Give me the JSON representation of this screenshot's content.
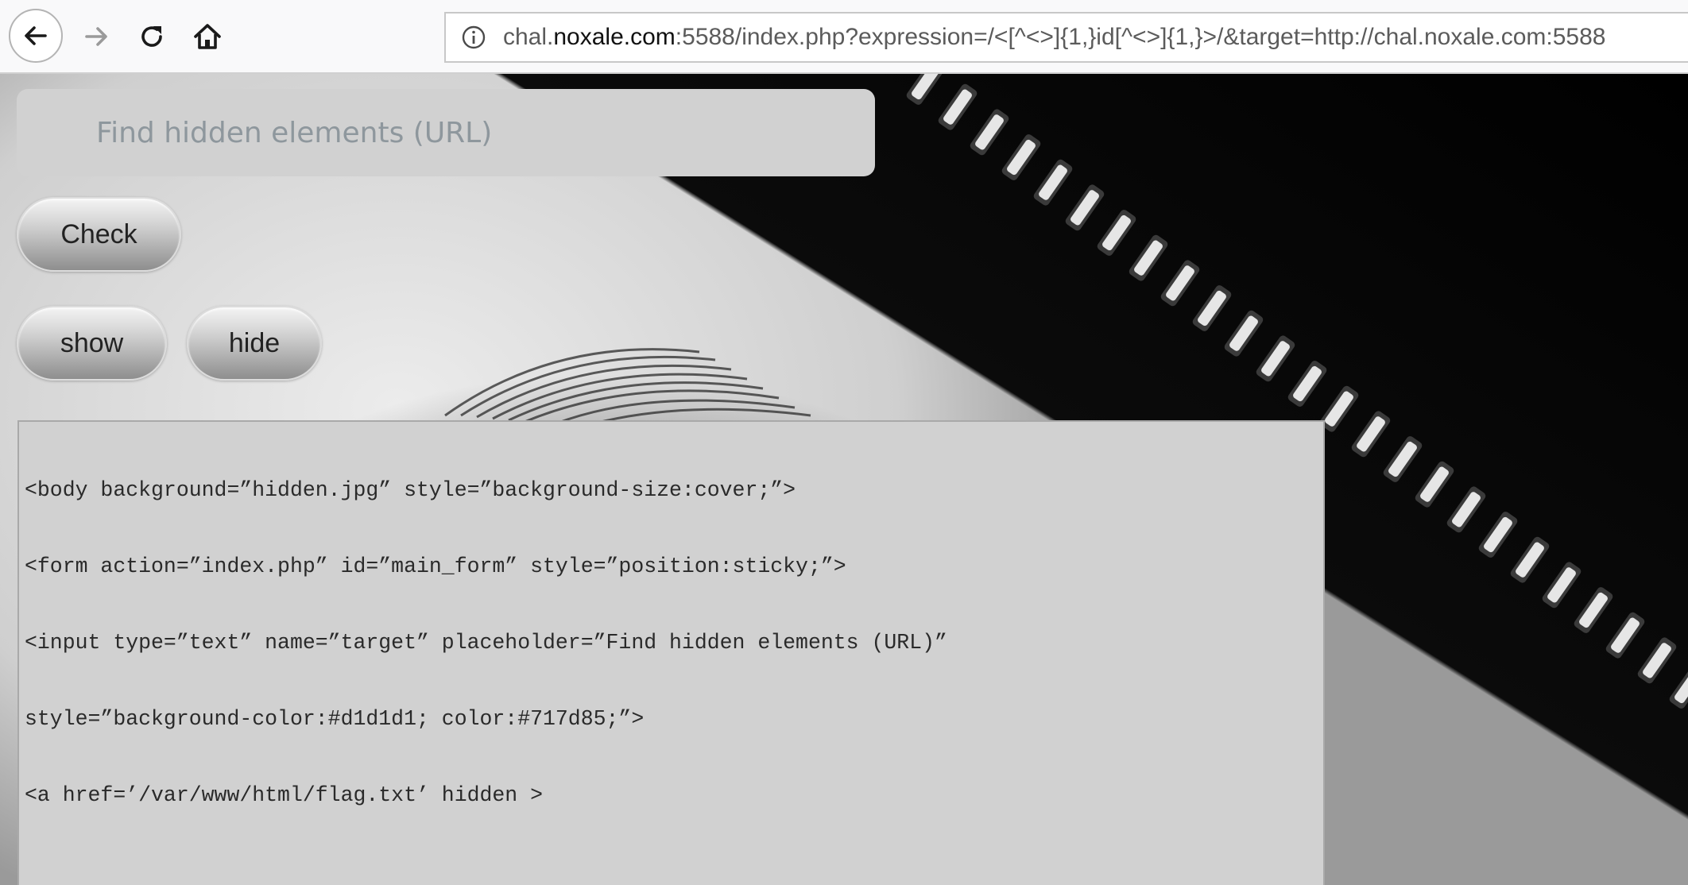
{
  "browser": {
    "url_prefix": "chal.",
    "url_domain": "noxale.com",
    "url_rest": ":5588/index.php?expression=/<[^<>]{1,}id[^<>]{1,}>/&target=http://chal.noxale.com:5588",
    "icons": {
      "back": "back-arrow-icon",
      "forward": "forward-arrow-icon",
      "reload": "reload-icon",
      "home": "home-icon",
      "info": "info-icon"
    }
  },
  "form": {
    "target_placeholder": "Find hidden elements (URL)",
    "target_value": "",
    "check_label": "Check",
    "show_label": "show",
    "hide_label": "hide"
  },
  "source": {
    "lines": [
      "<body background=”hidden.jpg” style=”background-size:cover;”>",
      "<form action=”index.php” id=”main_form” style=”position:sticky;”>",
      "<input type=”text” name=”target” placeholder=”Find hidden elements (URL)”",
      "style=”background-color:#d1d1d1; color:#717d85;”>",
      "<a href=’/var/www/html/flag.txt’ hidden >"
    ]
  },
  "colors": {
    "input_bg": "#d1d1d1",
    "input_text": "#717d85"
  }
}
